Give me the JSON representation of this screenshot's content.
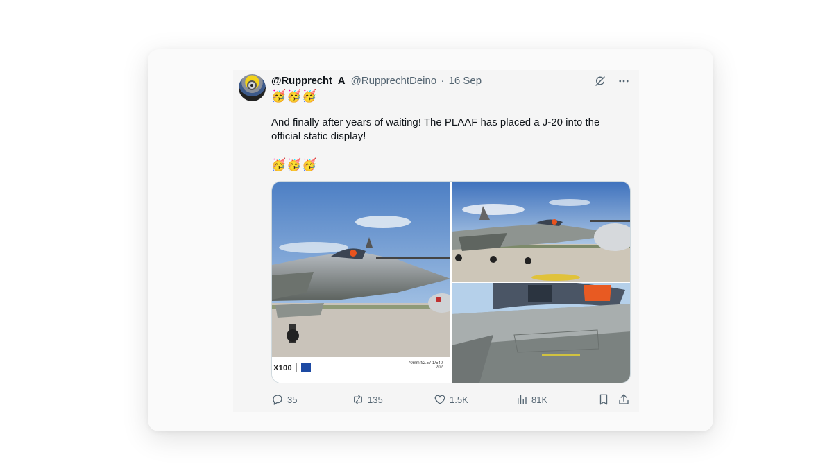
{
  "tweet": {
    "display_name": "@Rupprecht_A",
    "handle": "@RupprechtDeino",
    "separator": "·",
    "date": "16 Sep",
    "emoji_line_1": "🥳🥳🥳",
    "body_text": "And finally after years of waiting! The PLAAF has placed a J-20 into the official static display!",
    "emoji_line_2": "🥳🥳🥳"
  },
  "media": {
    "watermark_brand": "X100",
    "watermark_separator": "|",
    "watermark_spec": "70mm f/2.57 1/540",
    "watermark_date": "202"
  },
  "actions": {
    "replies": "35",
    "reposts": "135",
    "likes": "1.5K",
    "views": "81K"
  },
  "icons": [
    "grok-icon",
    "more-icon",
    "reply-icon",
    "repost-icon",
    "like-icon",
    "views-icon",
    "bookmark-icon",
    "share-icon"
  ]
}
